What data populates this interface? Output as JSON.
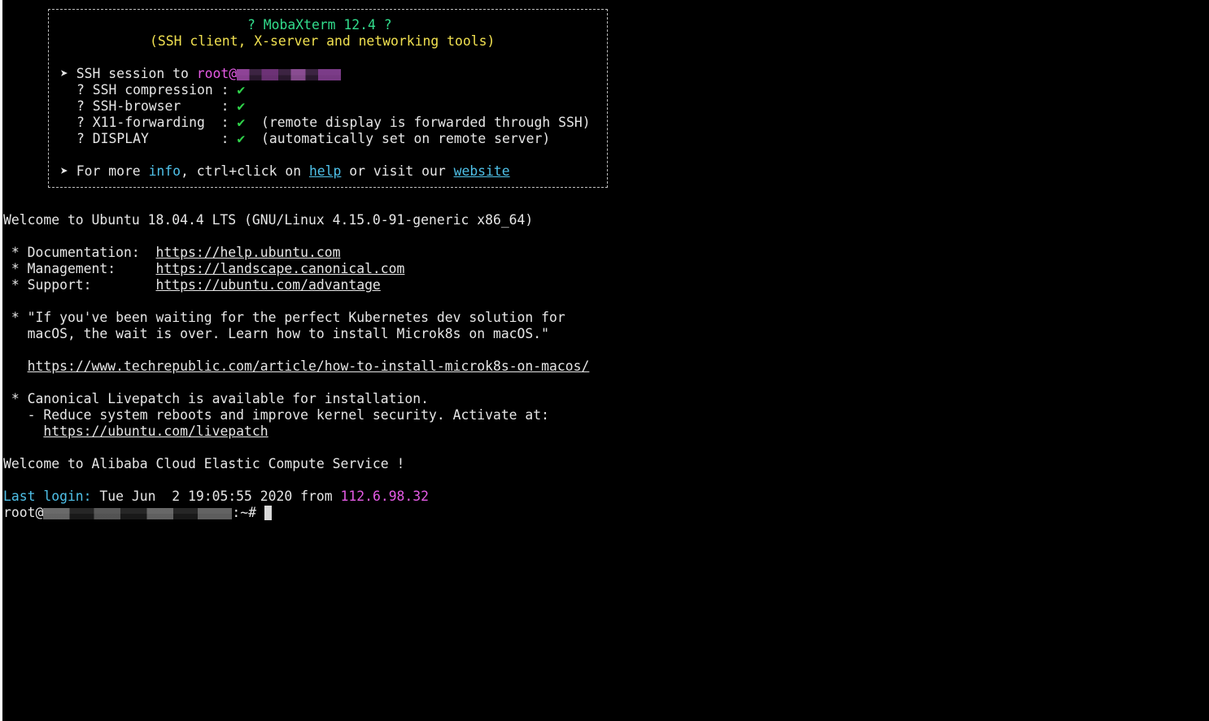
{
  "banner": {
    "title": "? MobaXterm 12.4 ?",
    "subtitle": "(SSH client, X-server and networking tools)",
    "session_prefix": "➤ SSH session to ",
    "session_user": "root@",
    "options": [
      {
        "label": "? SSH compression : ",
        "check": "✔",
        "note": ""
      },
      {
        "label": "? SSH-browser     : ",
        "check": "✔",
        "note": ""
      },
      {
        "label": "? X11-forwarding  : ",
        "check": "✔",
        "note": "  (remote display is forwarded through SSH)"
      },
      {
        "label": "? DISPLAY         : ",
        "check": "✔",
        "note": "  (automatically set on remote server)"
      }
    ],
    "more_prefix": "➤ For more ",
    "more_info": "info",
    "more_mid": ", ctrl+click on ",
    "more_help": "help",
    "more_mid2": " or visit our ",
    "more_website": "website"
  },
  "motd": {
    "welcome": "Welcome to Ubuntu 18.04.4 LTS (GNU/Linux 4.15.0-91-generic x86_64)",
    "links": [
      {
        "label": " * Documentation:  ",
        "url": "https://help.ubuntu.com"
      },
      {
        "label": " * Management:     ",
        "url": "https://landscape.canonical.com"
      },
      {
        "label": " * Support:        ",
        "url": "https://ubuntu.com/advantage"
      }
    ],
    "news_line1": " * \"If you've been waiting for the perfect Kubernetes dev solution for",
    "news_line2": "   macOS, the wait is over. Learn how to install Microk8s on macOS.\"",
    "news_indent": "   ",
    "news_url": "https://www.techrepublic.com/article/how-to-install-microk8s-on-macos/",
    "livepatch_line1": " * Canonical Livepatch is available for installation.",
    "livepatch_line2": "   - Reduce system reboots and improve kernel security. Activate at:",
    "livepatch_indent": "     ",
    "livepatch_url": "https://ubuntu.com/livepatch",
    "alibaba": "Welcome to Alibaba Cloud Elastic Compute Service !"
  },
  "login": {
    "label": "Last login:",
    "details": " Tue Jun  2 19:05:55 2020 from ",
    "ip": "112.6.98.32"
  },
  "prompt": {
    "user": "root@",
    "suffix": ":~# "
  },
  "colors": {
    "background": "#000000",
    "text": "#e6e6e6",
    "green": "#32dc8c",
    "yellow": "#f0e050",
    "magenta": "#e55be5",
    "cyan": "#4fc1e9",
    "check": "#2fd24a"
  }
}
